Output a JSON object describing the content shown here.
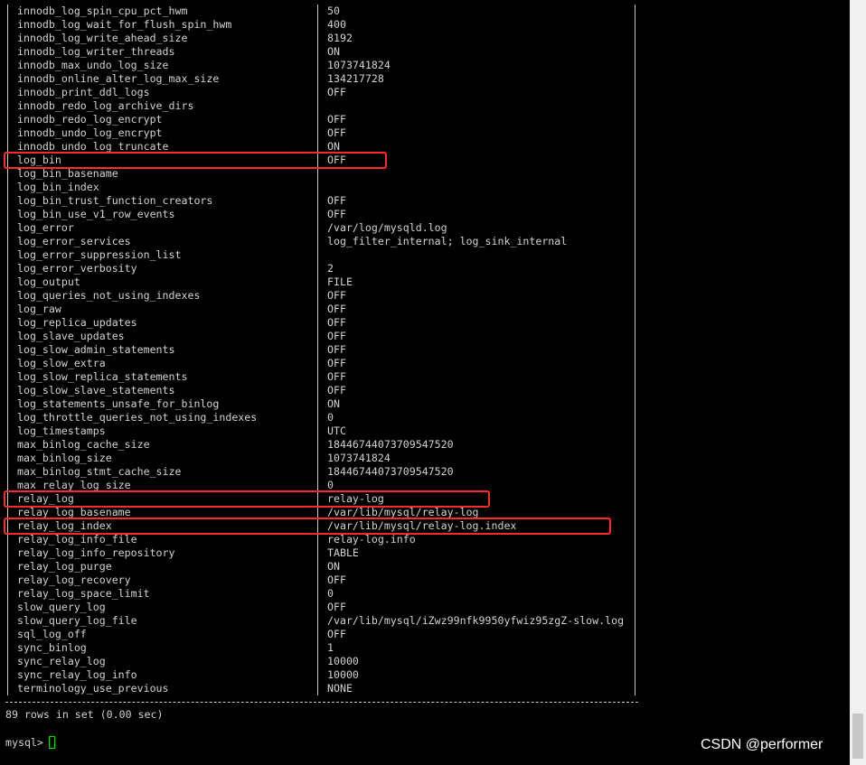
{
  "rows": [
    {
      "name": "innodb_log_spin_cpu_pct_hwm",
      "value": "50"
    },
    {
      "name": "innodb_log_wait_for_flush_spin_hwm",
      "value": "400"
    },
    {
      "name": "innodb_log_write_ahead_size",
      "value": "8192"
    },
    {
      "name": "innodb_log_writer_threads",
      "value": "ON"
    },
    {
      "name": "innodb_max_undo_log_size",
      "value": "1073741824"
    },
    {
      "name": "innodb_online_alter_log_max_size",
      "value": "134217728"
    },
    {
      "name": "innodb_print_ddl_logs",
      "value": "OFF"
    },
    {
      "name": "innodb_redo_log_archive_dirs",
      "value": ""
    },
    {
      "name": "innodb_redo_log_encrypt",
      "value": "OFF"
    },
    {
      "name": "innodb_undo_log_encrypt",
      "value": "OFF"
    },
    {
      "name": "innodb_undo_log_truncate",
      "value": "ON"
    },
    {
      "name": "log_bin",
      "value": "OFF"
    },
    {
      "name": "log_bin_basename",
      "value": ""
    },
    {
      "name": "log_bin_index",
      "value": ""
    },
    {
      "name": "log_bin_trust_function_creators",
      "value": "OFF"
    },
    {
      "name": "log_bin_use_v1_row_events",
      "value": "OFF"
    },
    {
      "name": "log_error",
      "value": "/var/log/mysqld.log"
    },
    {
      "name": "log_error_services",
      "value": "log_filter_internal; log_sink_internal"
    },
    {
      "name": "log_error_suppression_list",
      "value": ""
    },
    {
      "name": "log_error_verbosity",
      "value": "2"
    },
    {
      "name": "log_output",
      "value": "FILE"
    },
    {
      "name": "log_queries_not_using_indexes",
      "value": "OFF"
    },
    {
      "name": "log_raw",
      "value": "OFF"
    },
    {
      "name": "log_replica_updates",
      "value": "OFF"
    },
    {
      "name": "log_slave_updates",
      "value": "OFF"
    },
    {
      "name": "log_slow_admin_statements",
      "value": "OFF"
    },
    {
      "name": "log_slow_extra",
      "value": "OFF"
    },
    {
      "name": "log_slow_replica_statements",
      "value": "OFF"
    },
    {
      "name": "log_slow_slave_statements",
      "value": "OFF"
    },
    {
      "name": "log_statements_unsafe_for_binlog",
      "value": "ON"
    },
    {
      "name": "log_throttle_queries_not_using_indexes",
      "value": "0"
    },
    {
      "name": "log_timestamps",
      "value": "UTC"
    },
    {
      "name": "max_binlog_cache_size",
      "value": "18446744073709547520"
    },
    {
      "name": "max_binlog_size",
      "value": "1073741824"
    },
    {
      "name": "max_binlog_stmt_cache_size",
      "value": "18446744073709547520"
    },
    {
      "name": "max_relay_log_size",
      "value": "0"
    },
    {
      "name": "relay_log",
      "value": "relay-log"
    },
    {
      "name": "relay_log_basename",
      "value": "/var/lib/mysql/relay-log"
    },
    {
      "name": "relay_log_index",
      "value": "/var/lib/mysql/relay-log.index"
    },
    {
      "name": "relay_log_info_file",
      "value": "relay-log.info"
    },
    {
      "name": "relay_log_info_repository",
      "value": "TABLE"
    },
    {
      "name": "relay_log_purge",
      "value": "ON"
    },
    {
      "name": "relay_log_recovery",
      "value": "OFF"
    },
    {
      "name": "relay_log_space_limit",
      "value": "0"
    },
    {
      "name": "slow_query_log",
      "value": "OFF"
    },
    {
      "name": "slow_query_log_file",
      "value": "/var/lib/mysql/iZwz99nfk9950yfwiz95zgZ-slow.log"
    },
    {
      "name": "sql_log_off",
      "value": "OFF"
    },
    {
      "name": "sync_binlog",
      "value": "1"
    },
    {
      "name": "sync_relay_log",
      "value": "10000"
    },
    {
      "name": "sync_relay_log_info",
      "value": "10000"
    },
    {
      "name": "terminology_use_previous",
      "value": "NONE"
    }
  ],
  "highlighted_rows": [
    "log_bin",
    "relay_log",
    "relay_log_index"
  ],
  "result_summary": "89 rows in set (0.00 sec)",
  "prompt": "mysql> ",
  "watermark": "CSDN @performer",
  "colors": {
    "background": "#000000",
    "text": "#d2d2d2",
    "highlight_border": "#ff2a2a",
    "cursor": "#00e000",
    "scrollbar": "#f0f0f0"
  }
}
